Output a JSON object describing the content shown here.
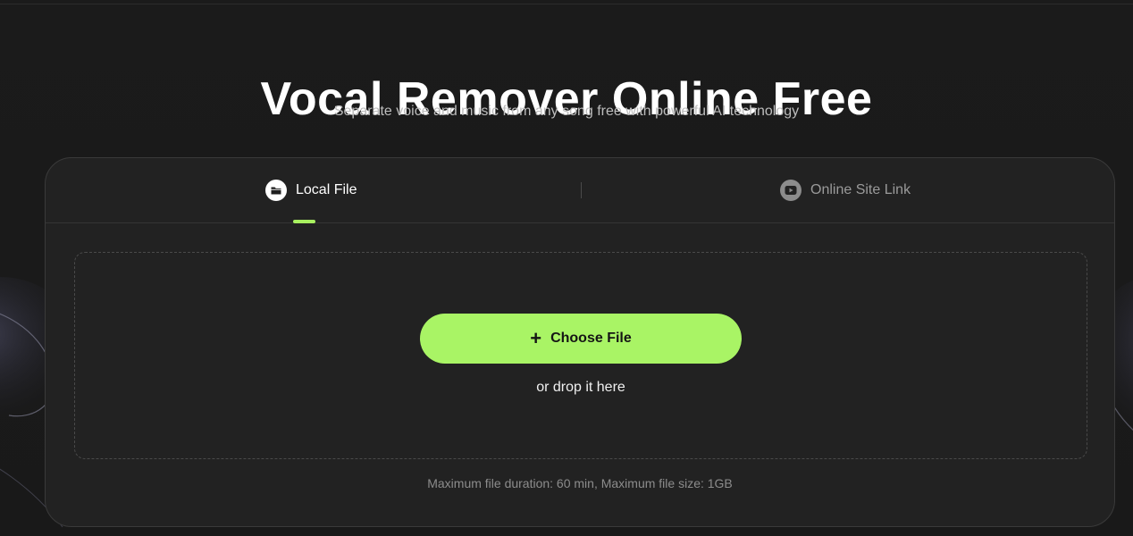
{
  "hero": {
    "title": "Vocal Remover Online Free",
    "subtitle": "Separate voice and music from any song free with powerful AI technology"
  },
  "tabs": [
    {
      "label": "Local File",
      "icon": "folder-icon",
      "active": true
    },
    {
      "label": "Online Site Link",
      "icon": "play-circle-icon",
      "active": false
    }
  ],
  "upload": {
    "button_label": "Choose File",
    "button_icon": "plus-icon",
    "drop_text": "or drop it here",
    "limits_text": "Maximum file duration: 60 min, Maximum file size: 1GB"
  },
  "colors": {
    "accent": "#a9f465",
    "background": "#1a1a1a",
    "card": "#222222"
  }
}
